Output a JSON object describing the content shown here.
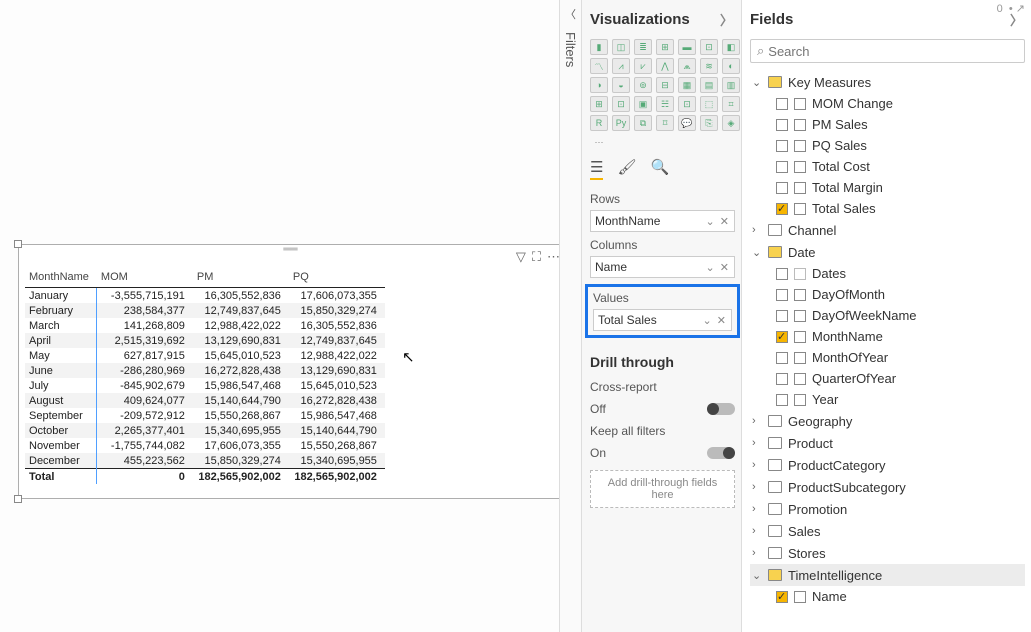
{
  "panes": {
    "filters_label": "Filters",
    "visualizations_title": "Visualizations",
    "fields_title": "Fields"
  },
  "search": {
    "placeholder": "Search"
  },
  "matrix": {
    "headers": [
      "MonthName",
      "MOM",
      "PM",
      "PQ"
    ],
    "rows": [
      {
        "month": "January",
        "mom": "-3,555,715,191",
        "pm": "16,305,552,836",
        "pq": "17,606,073,355"
      },
      {
        "month": "February",
        "mom": "238,584,377",
        "pm": "12,749,837,645",
        "pq": "15,850,329,274"
      },
      {
        "month": "March",
        "mom": "141,268,809",
        "pm": "12,988,422,022",
        "pq": "16,305,552,836"
      },
      {
        "month": "April",
        "mom": "2,515,319,692",
        "pm": "13,129,690,831",
        "pq": "12,749,837,645"
      },
      {
        "month": "May",
        "mom": "627,817,915",
        "pm": "15,645,010,523",
        "pq": "12,988,422,022"
      },
      {
        "month": "June",
        "mom": "-286,280,969",
        "pm": "16,272,828,438",
        "pq": "13,129,690,831"
      },
      {
        "month": "July",
        "mom": "-845,902,679",
        "pm": "15,986,547,468",
        "pq": "15,645,010,523"
      },
      {
        "month": "August",
        "mom": "409,624,077",
        "pm": "15,140,644,790",
        "pq": "16,272,828,438"
      },
      {
        "month": "September",
        "mom": "-209,572,912",
        "pm": "15,550,268,867",
        "pq": "15,986,547,468"
      },
      {
        "month": "October",
        "mom": "2,265,377,401",
        "pm": "15,340,695,955",
        "pq": "15,140,644,790"
      },
      {
        "month": "November",
        "mom": "-1,755,744,082",
        "pm": "17,606,073,355",
        "pq": "15,550,268,867"
      },
      {
        "month": "December",
        "mom": "455,223,562",
        "pm": "15,850,329,274",
        "pq": "15,340,695,955"
      }
    ],
    "total": {
      "label": "Total",
      "mom": "0",
      "pm": "182,565,902,002",
      "pq": "182,565,902,002"
    }
  },
  "viz": {
    "sections": {
      "rows": "Rows",
      "columns": "Columns",
      "values": "Values",
      "drill": "Drill through",
      "cross": "Cross-report",
      "keep": "Keep all filters",
      "off": "Off",
      "on": "On",
      "drill_drop": "Add drill-through fields here"
    },
    "wells": {
      "rows": "MonthName",
      "columns": "Name",
      "values": "Total Sales"
    }
  },
  "fields": {
    "key_measures": {
      "label": "Key Measures",
      "items": [
        {
          "label": "MOM Change",
          "checked": false
        },
        {
          "label": "PM Sales",
          "checked": false
        },
        {
          "label": "PQ Sales",
          "checked": false
        },
        {
          "label": "Total Cost",
          "checked": false
        },
        {
          "label": "Total Margin",
          "checked": false
        },
        {
          "label": "Total Sales",
          "checked": true
        }
      ]
    },
    "channel": {
      "label": "Channel"
    },
    "date": {
      "label": "Date",
      "items": [
        {
          "label": "Dates",
          "checked": false,
          "hier": true
        },
        {
          "label": "DayOfMonth",
          "checked": false
        },
        {
          "label": "DayOfWeekName",
          "checked": false
        },
        {
          "label": "MonthName",
          "checked": true
        },
        {
          "label": "MonthOfYear",
          "checked": false
        },
        {
          "label": "QuarterOfYear",
          "checked": false
        },
        {
          "label": "Year",
          "checked": false
        }
      ]
    },
    "geography": {
      "label": "Geography"
    },
    "product": {
      "label": "Product"
    },
    "product_category": {
      "label": "ProductCategory"
    },
    "product_subcategory": {
      "label": "ProductSubcategory"
    },
    "promotion": {
      "label": "Promotion"
    },
    "sales": {
      "label": "Sales"
    },
    "stores": {
      "label": "Stores"
    },
    "time_intel": {
      "label": "TimeIntelligence",
      "items": [
        {
          "label": "Name",
          "checked": true
        }
      ]
    }
  }
}
